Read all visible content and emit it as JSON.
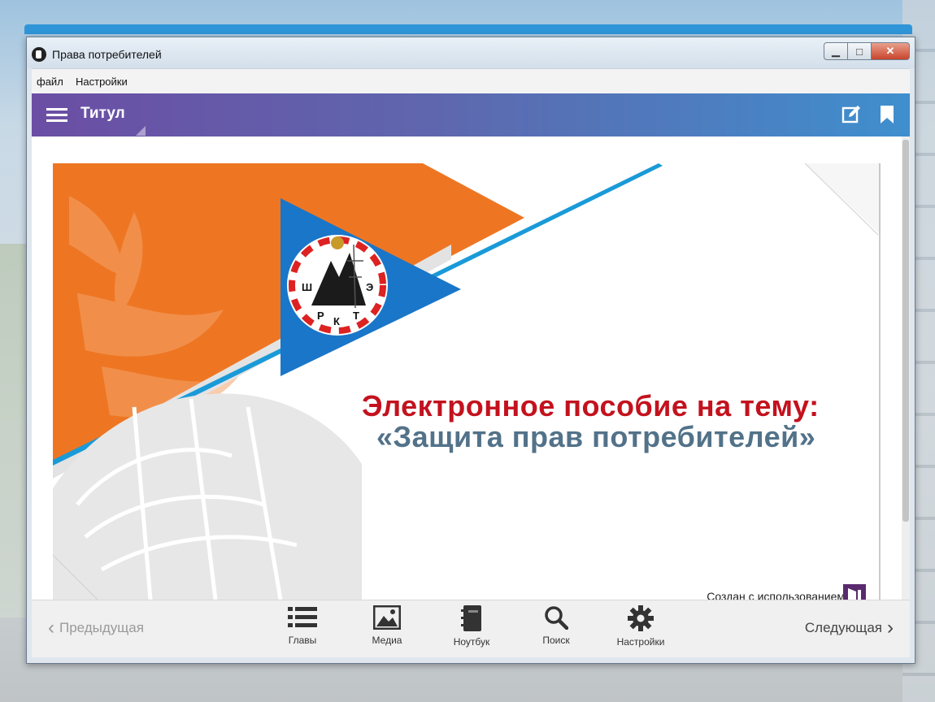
{
  "window": {
    "title": "Права потребителей",
    "controls": {
      "minimize": "▁",
      "maximize": "□",
      "close": "✕"
    }
  },
  "menu": {
    "items": [
      {
        "label": "файл"
      },
      {
        "label": "Настройки"
      }
    ]
  },
  "appbar": {
    "title": "Титул",
    "icons": [
      "hamburger-menu-icon",
      "edit-icon",
      "bookmark-icon"
    ],
    "gradient": [
      "#6b4ea4",
      "#3f8fce"
    ]
  },
  "slide": {
    "heading_line1": "Электронное пособие на тему:",
    "heading_line2": "«Защита прав потребителей»",
    "logo_letters": [
      "Ш",
      "Р",
      "К",
      "Т",
      "Э"
    ],
    "credit": "Создан с использованием",
    "colors": {
      "orange": "#ee7623",
      "blue": "#1a76c8",
      "red": "#c3121e",
      "gray_text": "#527289"
    }
  },
  "bottom": {
    "prev": "Предыдущая",
    "next": "Следующая",
    "tools": [
      {
        "label": "Главы",
        "icon": "list-icon"
      },
      {
        "label": "Медиа",
        "icon": "image-icon"
      },
      {
        "label": "Ноутбук",
        "icon": "notebook-icon"
      },
      {
        "label": "Поиск",
        "icon": "search-icon"
      },
      {
        "label": "Настройки",
        "icon": "gear-icon"
      }
    ]
  }
}
